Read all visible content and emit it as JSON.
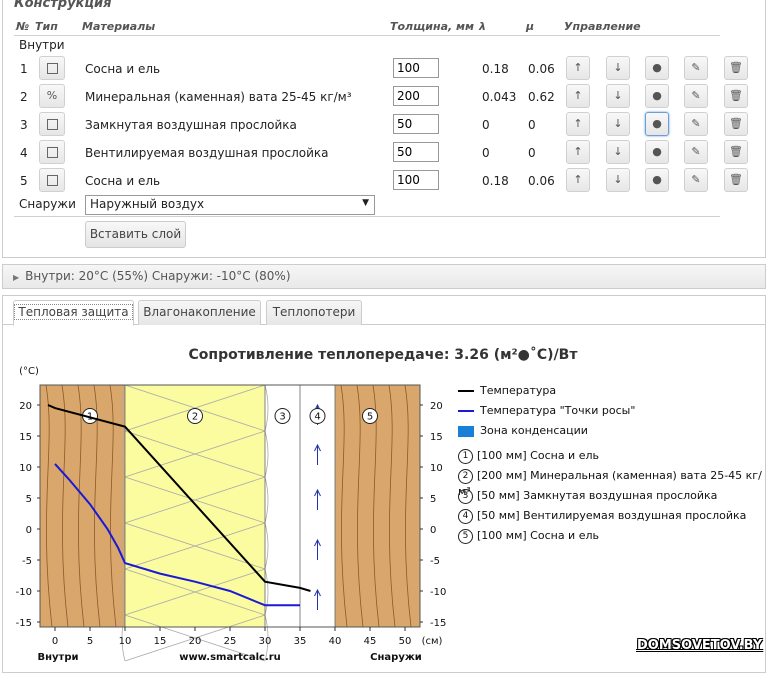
{
  "construction": {
    "title": "Конструкция",
    "headers": {
      "num": "№",
      "type": "Тип",
      "materials": "Материалы",
      "thickness": "Толщина, мм",
      "lambda": "λ",
      "mu": "μ",
      "control": "Управление"
    },
    "inside_label": "Внутри",
    "outside_label": "Снаружи",
    "outside_select": "Наружный воздух",
    "insert_button": "Вставить слой",
    "rows": [
      {
        "num": "1",
        "type_icon": "square-icon",
        "type_glyph": "",
        "material": "Сосна и ель",
        "thickness": "100",
        "lambda": "0.18",
        "mu": "0.06"
      },
      {
        "num": "2",
        "type_icon": "percent-icon",
        "type_glyph": "%",
        "material": "Минеральная (каменная) вата 25-45 кг/м³",
        "thickness": "200",
        "lambda": "0.043",
        "mu": "0.62"
      },
      {
        "num": "3",
        "type_icon": "square-icon",
        "type_glyph": "",
        "material": "Замкнутая воздушная прослойка",
        "thickness": "50",
        "lambda": "0",
        "mu": "0"
      },
      {
        "num": "4",
        "type_icon": "square-icon",
        "type_glyph": "",
        "material": "Вентилируемая воздушная прослойка",
        "thickness": "50",
        "lambda": "0",
        "mu": "0"
      },
      {
        "num": "5",
        "type_icon": "square-icon",
        "type_glyph": "",
        "material": "Сосна и ель",
        "thickness": "100",
        "lambda": "0.18",
        "mu": "0.06"
      }
    ],
    "control_glyphs": {
      "up": "↑",
      "down": "↓",
      "point": "●",
      "edit": "✎",
      "delete": "🗑"
    }
  },
  "conditions": {
    "text": "Внутри: 20°C (55%) Снаружи: -10°C (80%)"
  },
  "tabs": [
    "Тепловая защита",
    "Влагонакопление",
    "Теплопотери"
  ],
  "active_tab": 0,
  "chart": {
    "title": "Сопротивление теплопередаче: 3.26 (м²●˚С)/Вт",
    "ylabel": "(°C)",
    "xlabel": "(см)",
    "left_caption": "Внутри",
    "center_caption": "www.smartcalc.ru",
    "right_caption": "Снаружи"
  },
  "legend": {
    "temperature": "Температура",
    "dewpoint": "Температура \"Точки росы\"",
    "condensation": "Зона конденсации",
    "layers": [
      {
        "n": "1",
        "text": "[100 мм] Сосна и ель"
      },
      {
        "n": "2",
        "text": "[200 мм] Минеральная (каменная) вата 25-45 кг/м³"
      },
      {
        "n": "3",
        "text": "[50 мм] Замкнутая воздушная прослойка"
      },
      {
        "n": "4",
        "text": "[50 мм] Вентилируемая воздушная прослойка"
      },
      {
        "n": "5",
        "text": "[100 мм] Сосна и ель"
      }
    ]
  },
  "colors": {
    "wood": "#d9a66b",
    "wool": "#fbfba0",
    "temperature": "#000000",
    "dewpoint": "#1a1ad6",
    "condensation": "#1a7fd6"
  },
  "chart_data": {
    "type": "line",
    "x_ticks": [
      "0",
      "5",
      "10",
      "15",
      "20",
      "25",
      "30",
      "35",
      "40",
      "45",
      "50"
    ],
    "y_ticks": [
      "20",
      "15",
      "10",
      "5",
      "0",
      "-5",
      "-10",
      "-15"
    ],
    "xlim": [
      -2,
      50
    ],
    "ylim": [
      -15,
      22
    ],
    "layer_bounds_cm": [
      0,
      10,
      30,
      35,
      40,
      50
    ],
    "layer_labels": [
      "1",
      "2",
      "3",
      "4",
      "5"
    ],
    "series": [
      {
        "name": "Температура",
        "x": [
          -1,
          0,
          10,
          30,
          35,
          36.5
        ],
        "y": [
          20,
          19.5,
          16.5,
          -8.5,
          -9.5,
          -10
        ]
      },
      {
        "name": "Температура \"Точки росы\"",
        "x": [
          0,
          2,
          5,
          7.5,
          9,
          10,
          15,
          20,
          25,
          30,
          35
        ],
        "y": [
          10.5,
          8,
          4,
          0,
          -3,
          -5.5,
          -7.2,
          -8.5,
          -10,
          -12.3,
          -12.3
        ]
      }
    ]
  },
  "watermark": "DOMSOVETOV.BY"
}
